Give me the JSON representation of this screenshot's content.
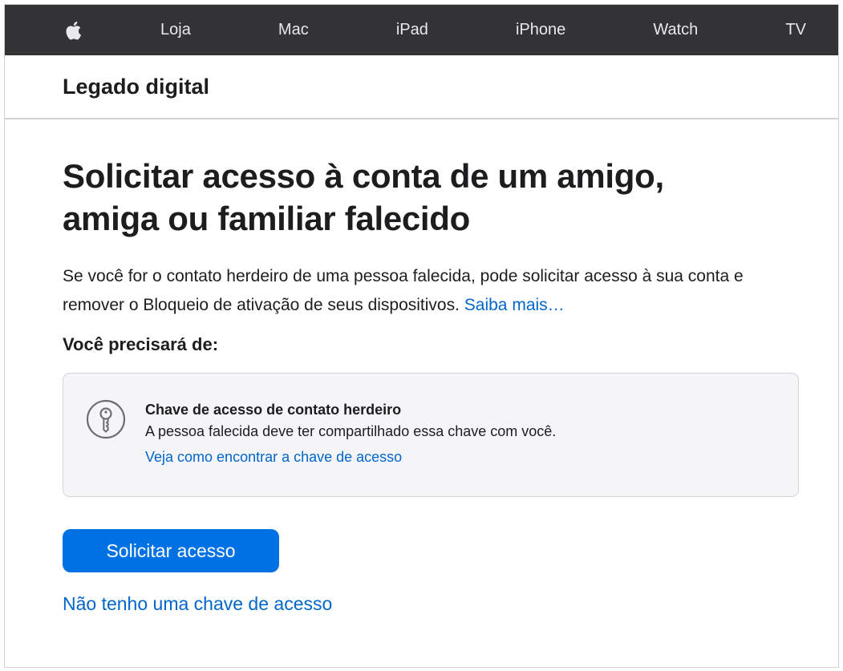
{
  "globalnav": {
    "apple_icon": "apple-logo-icon",
    "items": [
      "Loja",
      "Mac",
      "iPad",
      "iPhone",
      "Watch",
      "TV"
    ]
  },
  "localnav": {
    "title": "Legado digital"
  },
  "main": {
    "heading_line1": "Solicitar acesso à conta de um amigo,",
    "heading_line2": "amiga ou familiar falecido",
    "intro": "Se você for o contato herdeiro de uma pessoa falecida, pode solicitar acesso à sua conta e remover o Bloqueio de ativação de seus dispositivos. ",
    "learn_more": "Saiba mais…",
    "need_label": "Você precisará de:",
    "card": {
      "icon": "key-icon",
      "title": "Chave de acesso de contato herdeiro",
      "description": "A pessoa falecida deve ter compartilhado essa chave com você.",
      "link": "Veja como encontrar a chave de acesso"
    },
    "request_button": "Solicitar acesso",
    "no_key_link": "Não tenho uma chave de acesso"
  },
  "colors": {
    "nav_background": "#333336",
    "link": "#0066cc",
    "button": "#0071e3",
    "card_background": "#f5f5f7"
  }
}
